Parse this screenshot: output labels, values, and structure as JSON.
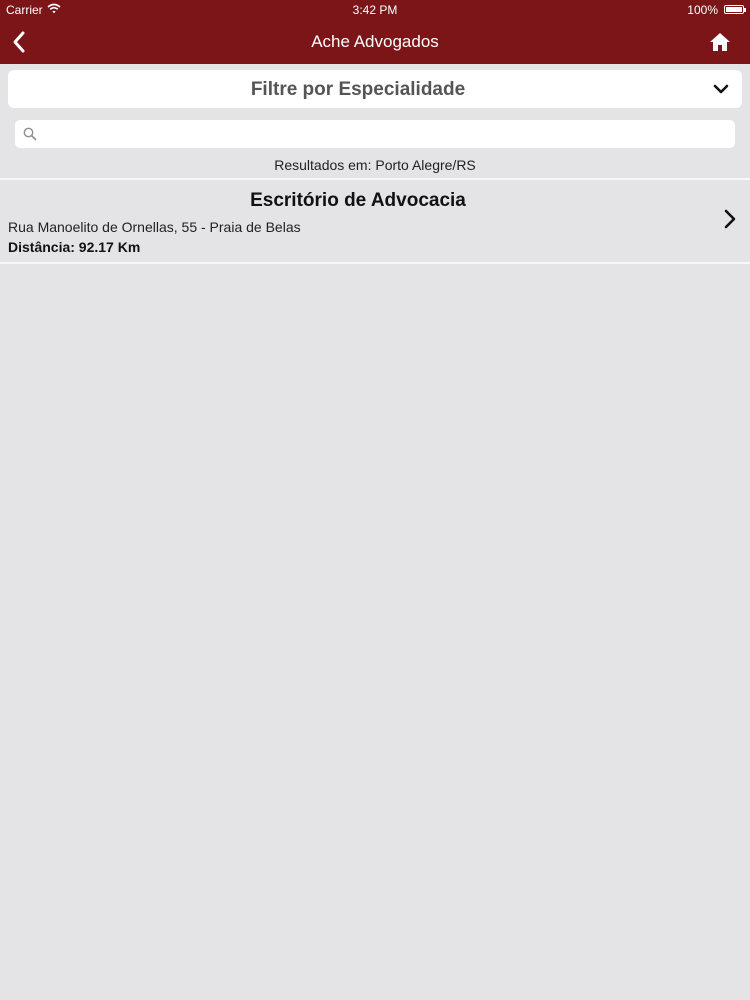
{
  "status_bar": {
    "carrier": "Carrier",
    "time": "3:42 PM",
    "battery": "100%"
  },
  "nav": {
    "title": "Ache Advogados",
    "back_icon": "chevron-left-icon",
    "home_icon": "home-icon"
  },
  "filter": {
    "label": "Filtre por Especialidade",
    "icon": "chevron-down-icon"
  },
  "search": {
    "placeholder": "",
    "value": ""
  },
  "results_label": "Resultados em: Porto Alegre/RS",
  "results": [
    {
      "name": "Escritório de Advocacia",
      "address": "Rua Manoelito de Ornellas, 55 - Praia de Belas",
      "distance": "Distância: 92.17 Km"
    }
  ],
  "colors": {
    "nav_background": "#7b1518",
    "page_background": "#e4e3e6"
  }
}
